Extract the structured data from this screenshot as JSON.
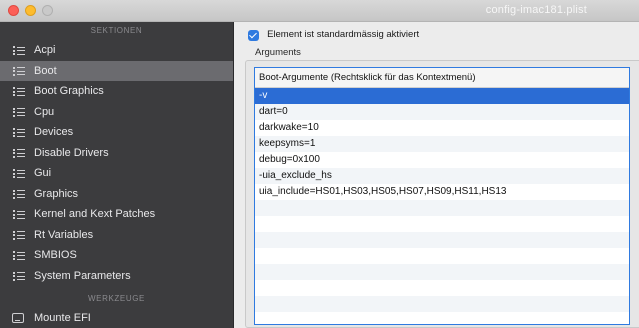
{
  "window": {
    "title": "config-imac181.plist"
  },
  "sidebar": {
    "sections_header": "SEKTIONEN",
    "items": [
      {
        "label": "Acpi",
        "icon": "list-icon"
      },
      {
        "label": "Boot",
        "icon": "list-icon",
        "selected": true
      },
      {
        "label": "Boot Graphics",
        "icon": "list-icon"
      },
      {
        "label": "Cpu",
        "icon": "list-icon"
      },
      {
        "label": "Devices",
        "icon": "list-icon"
      },
      {
        "label": "Disable Drivers",
        "icon": "list-icon"
      },
      {
        "label": "Gui",
        "icon": "list-icon"
      },
      {
        "label": "Graphics",
        "icon": "list-icon"
      },
      {
        "label": "Kernel and Kext Patches",
        "icon": "list-icon"
      },
      {
        "label": "Rt Variables",
        "icon": "list-icon"
      },
      {
        "label": "SMBIOS",
        "icon": "list-icon"
      },
      {
        "label": "System Parameters",
        "icon": "list-icon"
      }
    ],
    "tools_header": "WERKZEUGE",
    "tools": [
      {
        "label": "Mounte EFI",
        "icon": "disk-icon"
      }
    ]
  },
  "main": {
    "enabled_checkbox_label": "Element ist standardmässig aktiviert",
    "arguments_label": "Arguments",
    "table": {
      "header": "Boot-Argumente (Rechtsklick für das Kontextmenü)",
      "rows": [
        "-v",
        "dart=0",
        "darkwake=10",
        "keepsyms=1",
        "debug=0x100",
        "-uia_exclude_hs",
        "uia_include=HS01,HS03,HS05,HS07,HS09,HS11,HS13",
        "",
        "",
        "",
        "",
        "",
        "",
        ""
      ],
      "selected_row": 0
    }
  },
  "colors": {
    "accent": "#2f7ae0",
    "selection": "#2b6cd4",
    "sidebar_bg": "#3c3c3e",
    "sidebar_selected": "#6b6b6f"
  }
}
